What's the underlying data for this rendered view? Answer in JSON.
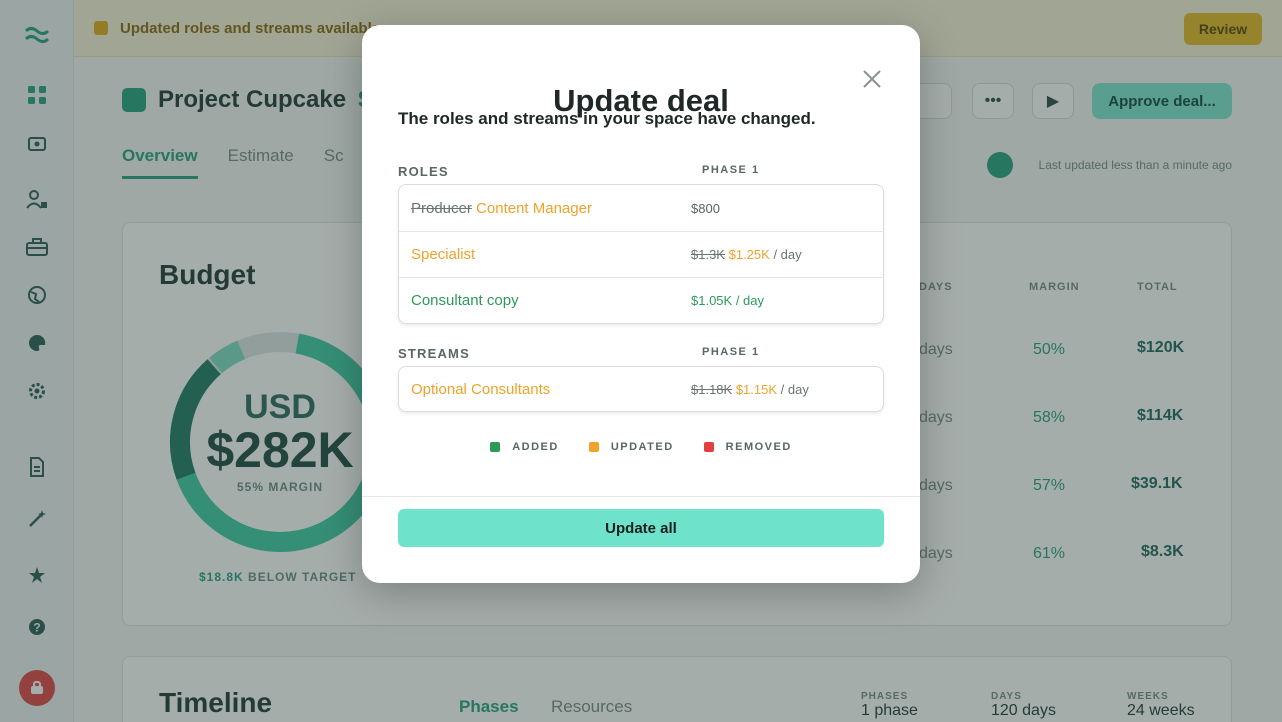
{
  "background": {
    "banner": {
      "text": "Updated roles and streams available",
      "review_label": "Review"
    },
    "project": {
      "name": "Project Cupcake",
      "amount": "$2"
    },
    "header_buttons": {
      "more_label": "•••",
      "play_label": "▶",
      "approve_label": "Approve deal..."
    },
    "tabs": [
      {
        "label": "Overview"
      },
      {
        "label": "Estimate"
      },
      {
        "label": "Sc"
      }
    ],
    "last_updated": "Last updated less than a minute ago",
    "budget": {
      "title": "Budget",
      "currency": "USD",
      "amount": "$282K",
      "margin": "55% MARGIN",
      "below_amount": "$18.8K",
      "below_text": "BELOW TARGET",
      "col_days": "DAYS",
      "col_margin": "MARGIN",
      "col_total": "TOTAL",
      "rows": [
        {
          "days": "days",
          "margin": "50%",
          "total": "$120K"
        },
        {
          "days": "days",
          "margin": "58%",
          "total": "$114K"
        },
        {
          "days": "days",
          "margin": "57%",
          "total": "$39.1K"
        },
        {
          "days": "days",
          "margin": "61%",
          "total": "$8.3K"
        }
      ]
    },
    "timeline": {
      "title": "Timeline",
      "tabs": [
        "Phases",
        "Resources"
      ],
      "stats": [
        {
          "label": "PHASES",
          "value": "1 phase"
        },
        {
          "label": "DAYS",
          "value": "120 days"
        },
        {
          "label": "WEEKS",
          "value": "24 weeks"
        }
      ]
    },
    "colors": {
      "brand": "#27a07f",
      "avatar": "#e14545"
    }
  },
  "modal": {
    "title": "Update deal",
    "subtitle": "The roles and streams in your space have changed.",
    "roles_heading": "ROLES",
    "streams_heading": "STREAMS",
    "phase_heading": "PHASE 1",
    "roles": [
      {
        "old_name": "Producer",
        "name": "Content Manager",
        "price": "$800"
      },
      {
        "name": "Specialist",
        "old_price": "$1.3K",
        "price": "$1.25K",
        "unit": "/ day"
      },
      {
        "name": "Consultant copy",
        "price": "$1.05K",
        "unit": "/ day"
      }
    ],
    "streams": [
      {
        "name": "Optional Consultants",
        "old_price": "$1.18K",
        "price": "$1.15K",
        "unit": "/ day"
      }
    ],
    "legend": [
      {
        "label": "ADDED",
        "color": "#2e9a5a"
      },
      {
        "label": "UPDATED",
        "color": "#f0a22a"
      },
      {
        "label": "REMOVED",
        "color": "#e0403f"
      }
    ],
    "update_all_label": "Update all",
    "close_icon": "close-icon"
  }
}
